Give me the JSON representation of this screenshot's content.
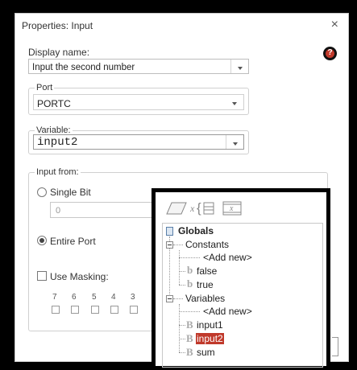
{
  "dialog": {
    "title": "Properties: Input",
    "close_glyph": "×",
    "help_glyph": "?",
    "display_name": {
      "label": "Display name:",
      "value": "Input the second number"
    },
    "port": {
      "label": "Port",
      "value": "PORTC"
    },
    "variable": {
      "label": "Variable:",
      "value": "input2"
    },
    "input_from": {
      "label": "Input from:",
      "single_bit": {
        "label": "Single Bit",
        "value": "0",
        "selected": false
      },
      "entire_port": {
        "label": "Entire Port",
        "selected": true
      },
      "use_masking": {
        "label": "Use Masking:",
        "checked": false
      },
      "bit_numbers": [
        "7",
        "6",
        "5",
        "4",
        "3"
      ]
    }
  },
  "popup": {
    "toolbar_icons": [
      "parallelogram-icon",
      "variable-braces-icon",
      "array-icon"
    ],
    "tree": {
      "root": "Globals",
      "constants": {
        "label": "Constants",
        "items": [
          "<Add new>",
          "false",
          "true"
        ]
      },
      "variables": {
        "label": "Variables",
        "items": [
          "<Add new>",
          "input1",
          "input2",
          "sum"
        ],
        "selected": "input2"
      },
      "type_glyphs": {
        "bool": "b",
        "byte": "B"
      }
    }
  }
}
